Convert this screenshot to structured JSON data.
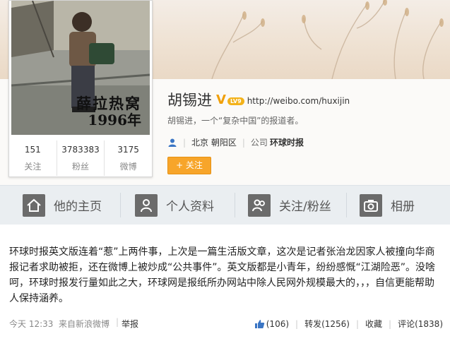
{
  "profile": {
    "name": "胡锡进",
    "verified_mark": "V",
    "level_badge": "LV9",
    "url": "http://weibo.com/huxijin",
    "bio": "胡锡进，一个“复杂中国”的报道者。",
    "location": "北京 朝阳区",
    "company_label": "公司",
    "company_name": "环球时报",
    "follow_button": "+ 关注",
    "avatar_caption_line1": "薛拉热窝",
    "avatar_caption_line2": "1996年"
  },
  "stats": [
    {
      "value": "151",
      "label": "关注"
    },
    {
      "value": "3783383",
      "label": "粉丝"
    },
    {
      "value": "3175",
      "label": "微博"
    }
  ],
  "tabs": [
    {
      "label": "他的主页",
      "icon": "home-icon"
    },
    {
      "label": "个人资料",
      "icon": "person-icon"
    },
    {
      "label": "关注/粉丝",
      "icon": "people-icon"
    },
    {
      "label": "相册",
      "icon": "camera-icon"
    }
  ],
  "post": {
    "text": "环球时报英文版连着“惹”上两件事，上次是一篇生活版文章，这次是记者张治龙因家人被撞向华商报记者求助被拒，还在微博上被炒成“公共事件”。英文版都是小青年，纷纷感慨“江湖险恶”。没啥呵，环球时报发行量如此之大，环球网是报纸所办网站中除人民网外规模最大的，，，自信更能帮助人保持涵养。",
    "time": "今天 12:33",
    "source": "来自新浪微博",
    "report": "举报",
    "likes": "(106)",
    "repost": "转发(1256)",
    "favorite": "收藏",
    "comment": "评论(1838)"
  },
  "colors": {
    "accent_orange": "#f7a52a",
    "verified_gold": "#f0a00a",
    "tab_bar_bg": "#eaeef1",
    "link_blue": "#3a75c4"
  }
}
